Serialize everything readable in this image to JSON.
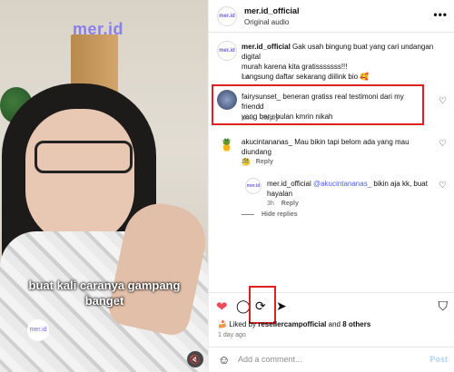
{
  "video": {
    "brand": "mer.id",
    "caption_line1": "buat kali caranya gampang",
    "caption_line2": "banget",
    "badge": "mer.id",
    "mute_icon": "speaker-muted-icon"
  },
  "header": {
    "username": "mer.id_official",
    "audio": "Original audio",
    "more": "•••",
    "avatar": "mer.id"
  },
  "comments": [
    {
      "user": "mer.id_official",
      "text_l1": " Gak usah bingung buat yang cari undangan digital",
      "text_l2": "murah karena kita gratisssssss!!!",
      "text_l3": "Langsung daftar sekarang diilink bio 🥰",
      "time": "1d",
      "avatar": "mer.id"
    },
    {
      "user": "fairysunset_",
      "text_l1": " beneran gratiss real testimoni dari my friendd",
      "text_l2": "yang baru bulan kmrin nikah",
      "time": "Now",
      "reply": "Reply"
    },
    {
      "user": "akucintananas_",
      "text_l1": " Mau bikin tapi belom ada yang mau diundang",
      "text_l2": "🤔",
      "time": "1d",
      "reply": "Reply",
      "avatar": "🍍"
    },
    {
      "user": "mer.id_official",
      "mention": " @akucintananas_",
      "text_l1": " bikin aja kk, buat",
      "text_l2": "hayalan",
      "time": "3h",
      "reply": "Reply",
      "avatar": "mer.id"
    }
  ],
  "hide_replies": "Hide replies",
  "actions": {
    "heart_icon": "heart-filled-icon",
    "liked_prefix": "Liked by ",
    "liked_user": "resellercampofficial",
    "liked_mid": " and ",
    "liked_count": "8 others",
    "ago": "1 day ago"
  },
  "addbar": {
    "placeholder": "Add a comment...",
    "post": "Post"
  },
  "colors": {
    "like_red": "#ed4956",
    "highlight_red": "#e02020",
    "mention_blue": "#4c5ee8",
    "brand_purple": "#8b7ff0"
  }
}
